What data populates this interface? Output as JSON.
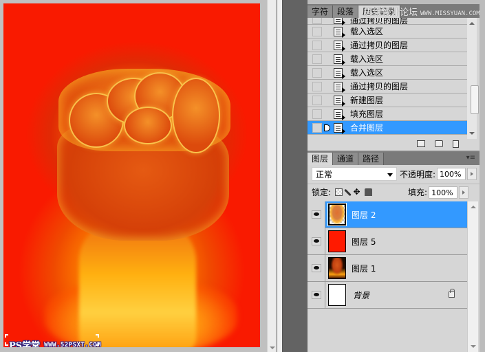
{
  "canvas": {
    "background_color": "#f91a00",
    "subject": "flaming fist",
    "watermark": {
      "brand": "PS学堂",
      "url": "WWW.52PSXT.COM"
    }
  },
  "history_panel": {
    "tabs": [
      {
        "label": "字符",
        "active": false
      },
      {
        "label": "段落",
        "active": false
      },
      {
        "label": "历史记录",
        "active": true
      }
    ],
    "watermark": {
      "text": "思缘设计论坛",
      "url": "WWW.MISSYUAN.COM"
    },
    "items": [
      {
        "label": "通过拷贝的图层",
        "selected": false,
        "partial": true
      },
      {
        "label": "载入选区",
        "selected": false
      },
      {
        "label": "通过拷贝的图层",
        "selected": false
      },
      {
        "label": "载入选区",
        "selected": false
      },
      {
        "label": "载入选区",
        "selected": false
      },
      {
        "label": "通过拷贝的图层",
        "selected": false
      },
      {
        "label": "新建图层",
        "selected": false
      },
      {
        "label": "填充图层",
        "selected": false
      },
      {
        "label": "合并图层",
        "selected": true
      }
    ],
    "footer_icons": [
      "new-document-from-state-icon",
      "snapshot-camera-icon",
      "trash-icon"
    ]
  },
  "layers_panel": {
    "tabs": [
      {
        "label": "图层",
        "active": true
      },
      {
        "label": "通道",
        "active": false
      },
      {
        "label": "路径",
        "active": false
      }
    ],
    "blend_mode": "正常",
    "opacity_label": "不透明度:",
    "opacity_value": "100%",
    "lock_label": "锁定:",
    "fill_label": "填充:",
    "fill_value": "100%",
    "layers": [
      {
        "name": "图层 2",
        "visible": true,
        "selected": true,
        "thumb": "fist-transparent",
        "locked": false
      },
      {
        "name": "图层 5",
        "visible": true,
        "selected": false,
        "thumb": "red-fill",
        "thumb_color": "#ff1a00",
        "locked": false
      },
      {
        "name": "图层 1",
        "visible": true,
        "selected": false,
        "thumb": "fist-dark",
        "locked": false
      },
      {
        "name": "背景",
        "visible": true,
        "selected": false,
        "thumb": "white",
        "locked": true
      }
    ]
  },
  "colors": {
    "selection": "#3399ff",
    "panel_bg": "#d6d6d6",
    "dock_dark": "#636363"
  }
}
